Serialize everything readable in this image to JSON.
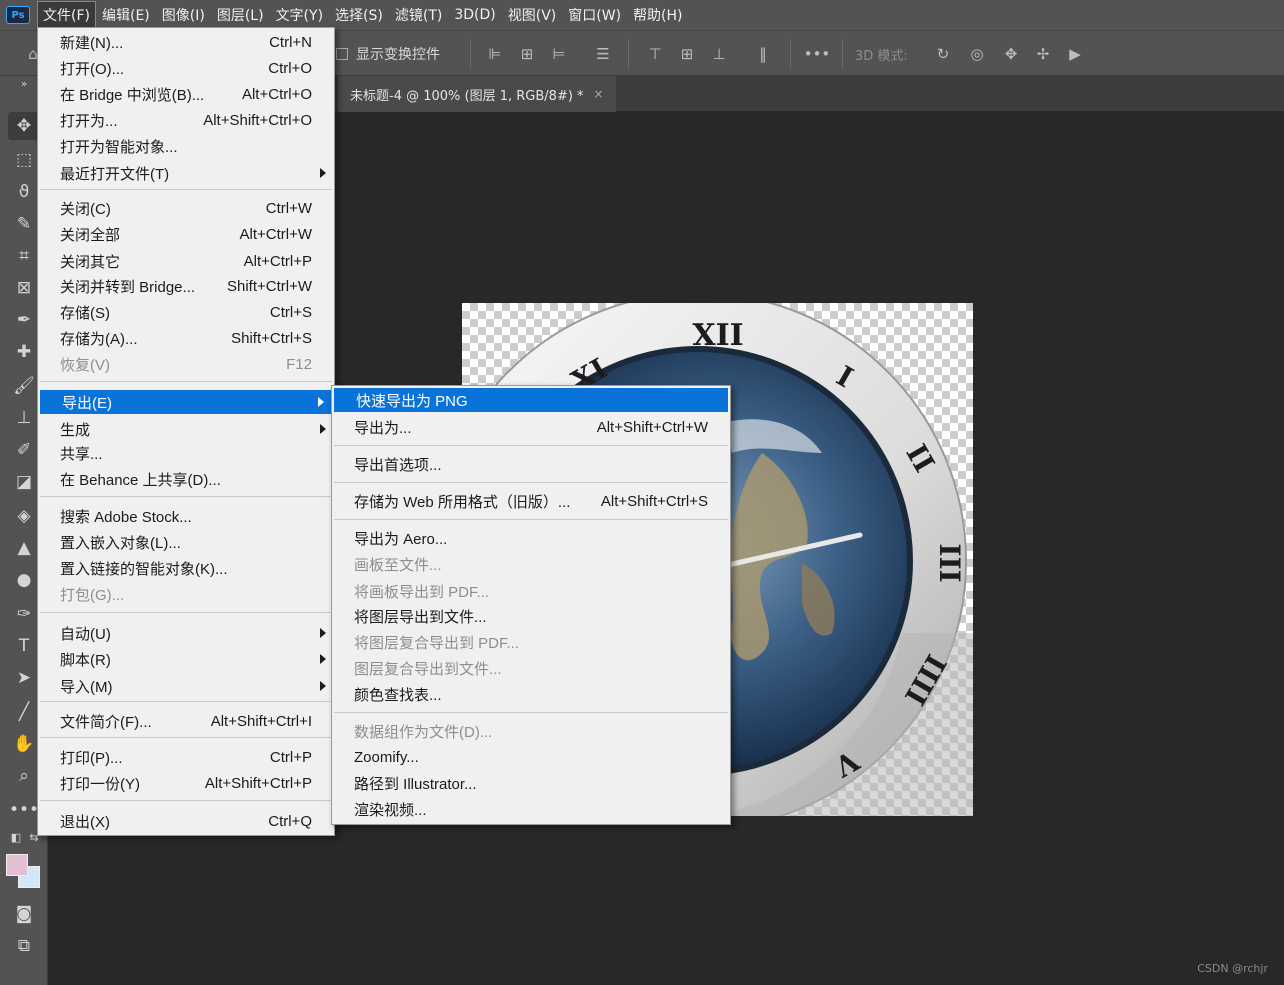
{
  "app": {
    "logo": "Ps"
  },
  "menubar": [
    {
      "label": "文件(F)",
      "active": true
    },
    {
      "label": "编辑(E)"
    },
    {
      "label": "图像(I)"
    },
    {
      "label": "图层(L)"
    },
    {
      "label": "文字(Y)"
    },
    {
      "label": "选择(S)"
    },
    {
      "label": "滤镜(T)"
    },
    {
      "label": "3D(D)"
    },
    {
      "label": "视图(V)"
    },
    {
      "label": "窗口(W)"
    },
    {
      "label": "帮助(H)"
    }
  ],
  "options_bar": {
    "show_transform_label": "显示变换控件",
    "show_transform_checked": false,
    "mode_label": "3D 模式:"
  },
  "document_tab": {
    "title": "未标题-4 @ 100% (图层 1, RGB/8#) *",
    "close": "×"
  },
  "clock_numerals": [
    "XII",
    "I",
    "II",
    "III",
    "IIII",
    "V",
    "XI"
  ],
  "file_menu": [
    {
      "label": "新建(N)...",
      "shortcut": "Ctrl+N"
    },
    {
      "label": "打开(O)...",
      "shortcut": "Ctrl+O"
    },
    {
      "label": "在 Bridge 中浏览(B)...",
      "shortcut": "Alt+Ctrl+O"
    },
    {
      "label": "打开为...",
      "shortcut": "Alt+Shift+Ctrl+O"
    },
    {
      "label": "打开为智能对象...",
      "shortcut": ""
    },
    {
      "label": "最近打开文件(T)",
      "shortcut": "",
      "submenu": true
    },
    {
      "label": "关闭(C)",
      "shortcut": "Ctrl+W"
    },
    {
      "label": "关闭全部",
      "shortcut": "Alt+Ctrl+W"
    },
    {
      "label": "关闭其它",
      "shortcut": "Alt+Ctrl+P"
    },
    {
      "label": "关闭并转到 Bridge...",
      "shortcut": "Shift+Ctrl+W"
    },
    {
      "label": "存储(S)",
      "shortcut": "Ctrl+S"
    },
    {
      "label": "存储为(A)...",
      "shortcut": "Shift+Ctrl+S"
    },
    {
      "label": "恢复(V)",
      "shortcut": "F12",
      "disabled": true
    },
    {
      "label": "导出(E)",
      "shortcut": "",
      "submenu": true,
      "highlight": true
    },
    {
      "label": "生成",
      "shortcut": "",
      "submenu": true
    },
    {
      "label": "共享...",
      "shortcut": ""
    },
    {
      "label": "在 Behance 上共享(D)...",
      "shortcut": ""
    },
    {
      "label": "搜索 Adobe Stock...",
      "shortcut": ""
    },
    {
      "label": "置入嵌入对象(L)...",
      "shortcut": ""
    },
    {
      "label": "置入链接的智能对象(K)...",
      "shortcut": ""
    },
    {
      "label": "打包(G)...",
      "shortcut": "",
      "disabled": true
    },
    {
      "label": "自动(U)",
      "shortcut": "",
      "submenu": true
    },
    {
      "label": "脚本(R)",
      "shortcut": "",
      "submenu": true
    },
    {
      "label": "导入(M)",
      "shortcut": "",
      "submenu": true
    },
    {
      "label": "文件简介(F)...",
      "shortcut": "Alt+Shift+Ctrl+I"
    },
    {
      "label": "打印(P)...",
      "shortcut": "Ctrl+P"
    },
    {
      "label": "打印一份(Y)",
      "shortcut": "Alt+Shift+Ctrl+P"
    },
    {
      "label": "退出(X)",
      "shortcut": "Ctrl+Q"
    }
  ],
  "export_submenu": [
    {
      "label": "快速导出为 PNG",
      "shortcut": "",
      "highlight": true
    },
    {
      "label": "导出为...",
      "shortcut": "Alt+Shift+Ctrl+W"
    },
    {
      "label": "导出首选项...",
      "shortcut": ""
    },
    {
      "label": "存储为 Web 所用格式（旧版）...",
      "shortcut": "Alt+Shift+Ctrl+S"
    },
    {
      "label": "导出为 Aero...",
      "shortcut": ""
    },
    {
      "label": "画板至文件...",
      "shortcut": "",
      "disabled": true
    },
    {
      "label": "将画板导出到 PDF...",
      "shortcut": "",
      "disabled": true
    },
    {
      "label": "将图层导出到文件...",
      "shortcut": ""
    },
    {
      "label": "将图层复合导出到 PDF...",
      "shortcut": "",
      "disabled": true
    },
    {
      "label": "图层复合导出到文件...",
      "shortcut": "",
      "disabled": true
    },
    {
      "label": "颜色查找表...",
      "shortcut": ""
    },
    {
      "label": "数据组作为文件(D)...",
      "shortcut": "",
      "disabled": true
    },
    {
      "label": "Zoomify...",
      "shortcut": ""
    },
    {
      "label": "路径到 Illustrator...",
      "shortcut": ""
    },
    {
      "label": "渲染视频...",
      "shortcut": ""
    }
  ],
  "colors": {
    "foreground_swatch": "#e3bfd3",
    "background_swatch": "#d5e6f7",
    "menu_highlight": "#0a73d9"
  },
  "watermark": "CSDN @rchjr"
}
